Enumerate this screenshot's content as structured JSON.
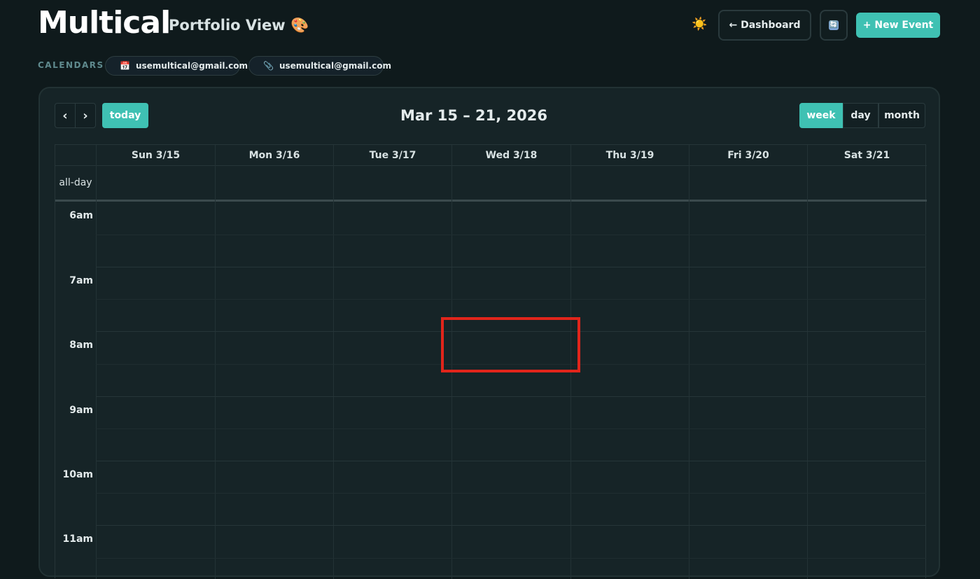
{
  "header": {
    "logo": "Multical",
    "subtitle": "Portfolio View 🎨",
    "theme_icon": "☀️",
    "dashboard_label": "← Dashboard",
    "sync_icon": "🔄",
    "new_event_label": "+ New Event"
  },
  "calendars": {
    "label": "CALENDARS",
    "items": [
      {
        "color": "#2bb39c",
        "emoji": "📅",
        "email": "usemultical@gmail.com"
      },
      {
        "color": "#5a5df0",
        "emoji": "📎",
        "email": "usemultical@gmail.com"
      }
    ]
  },
  "toolbar": {
    "prev": "‹",
    "next": "›",
    "today": "today",
    "range": "Mar 15 – 21, 2026",
    "views": [
      "week",
      "day",
      "month"
    ],
    "active_view": "week"
  },
  "week": {
    "days": [
      "Sun 3/15",
      "Mon 3/16",
      "Tue 3/17",
      "Wed 3/18",
      "Thu 3/19",
      "Fri 3/20",
      "Sat 3/21"
    ],
    "allday_label": "all-day",
    "hours": [
      "6am",
      "7am",
      "8am",
      "9am",
      "10am",
      "11am"
    ]
  },
  "colors": {
    "accent": "#3fc1b3",
    "highlight": "#e1251b"
  }
}
